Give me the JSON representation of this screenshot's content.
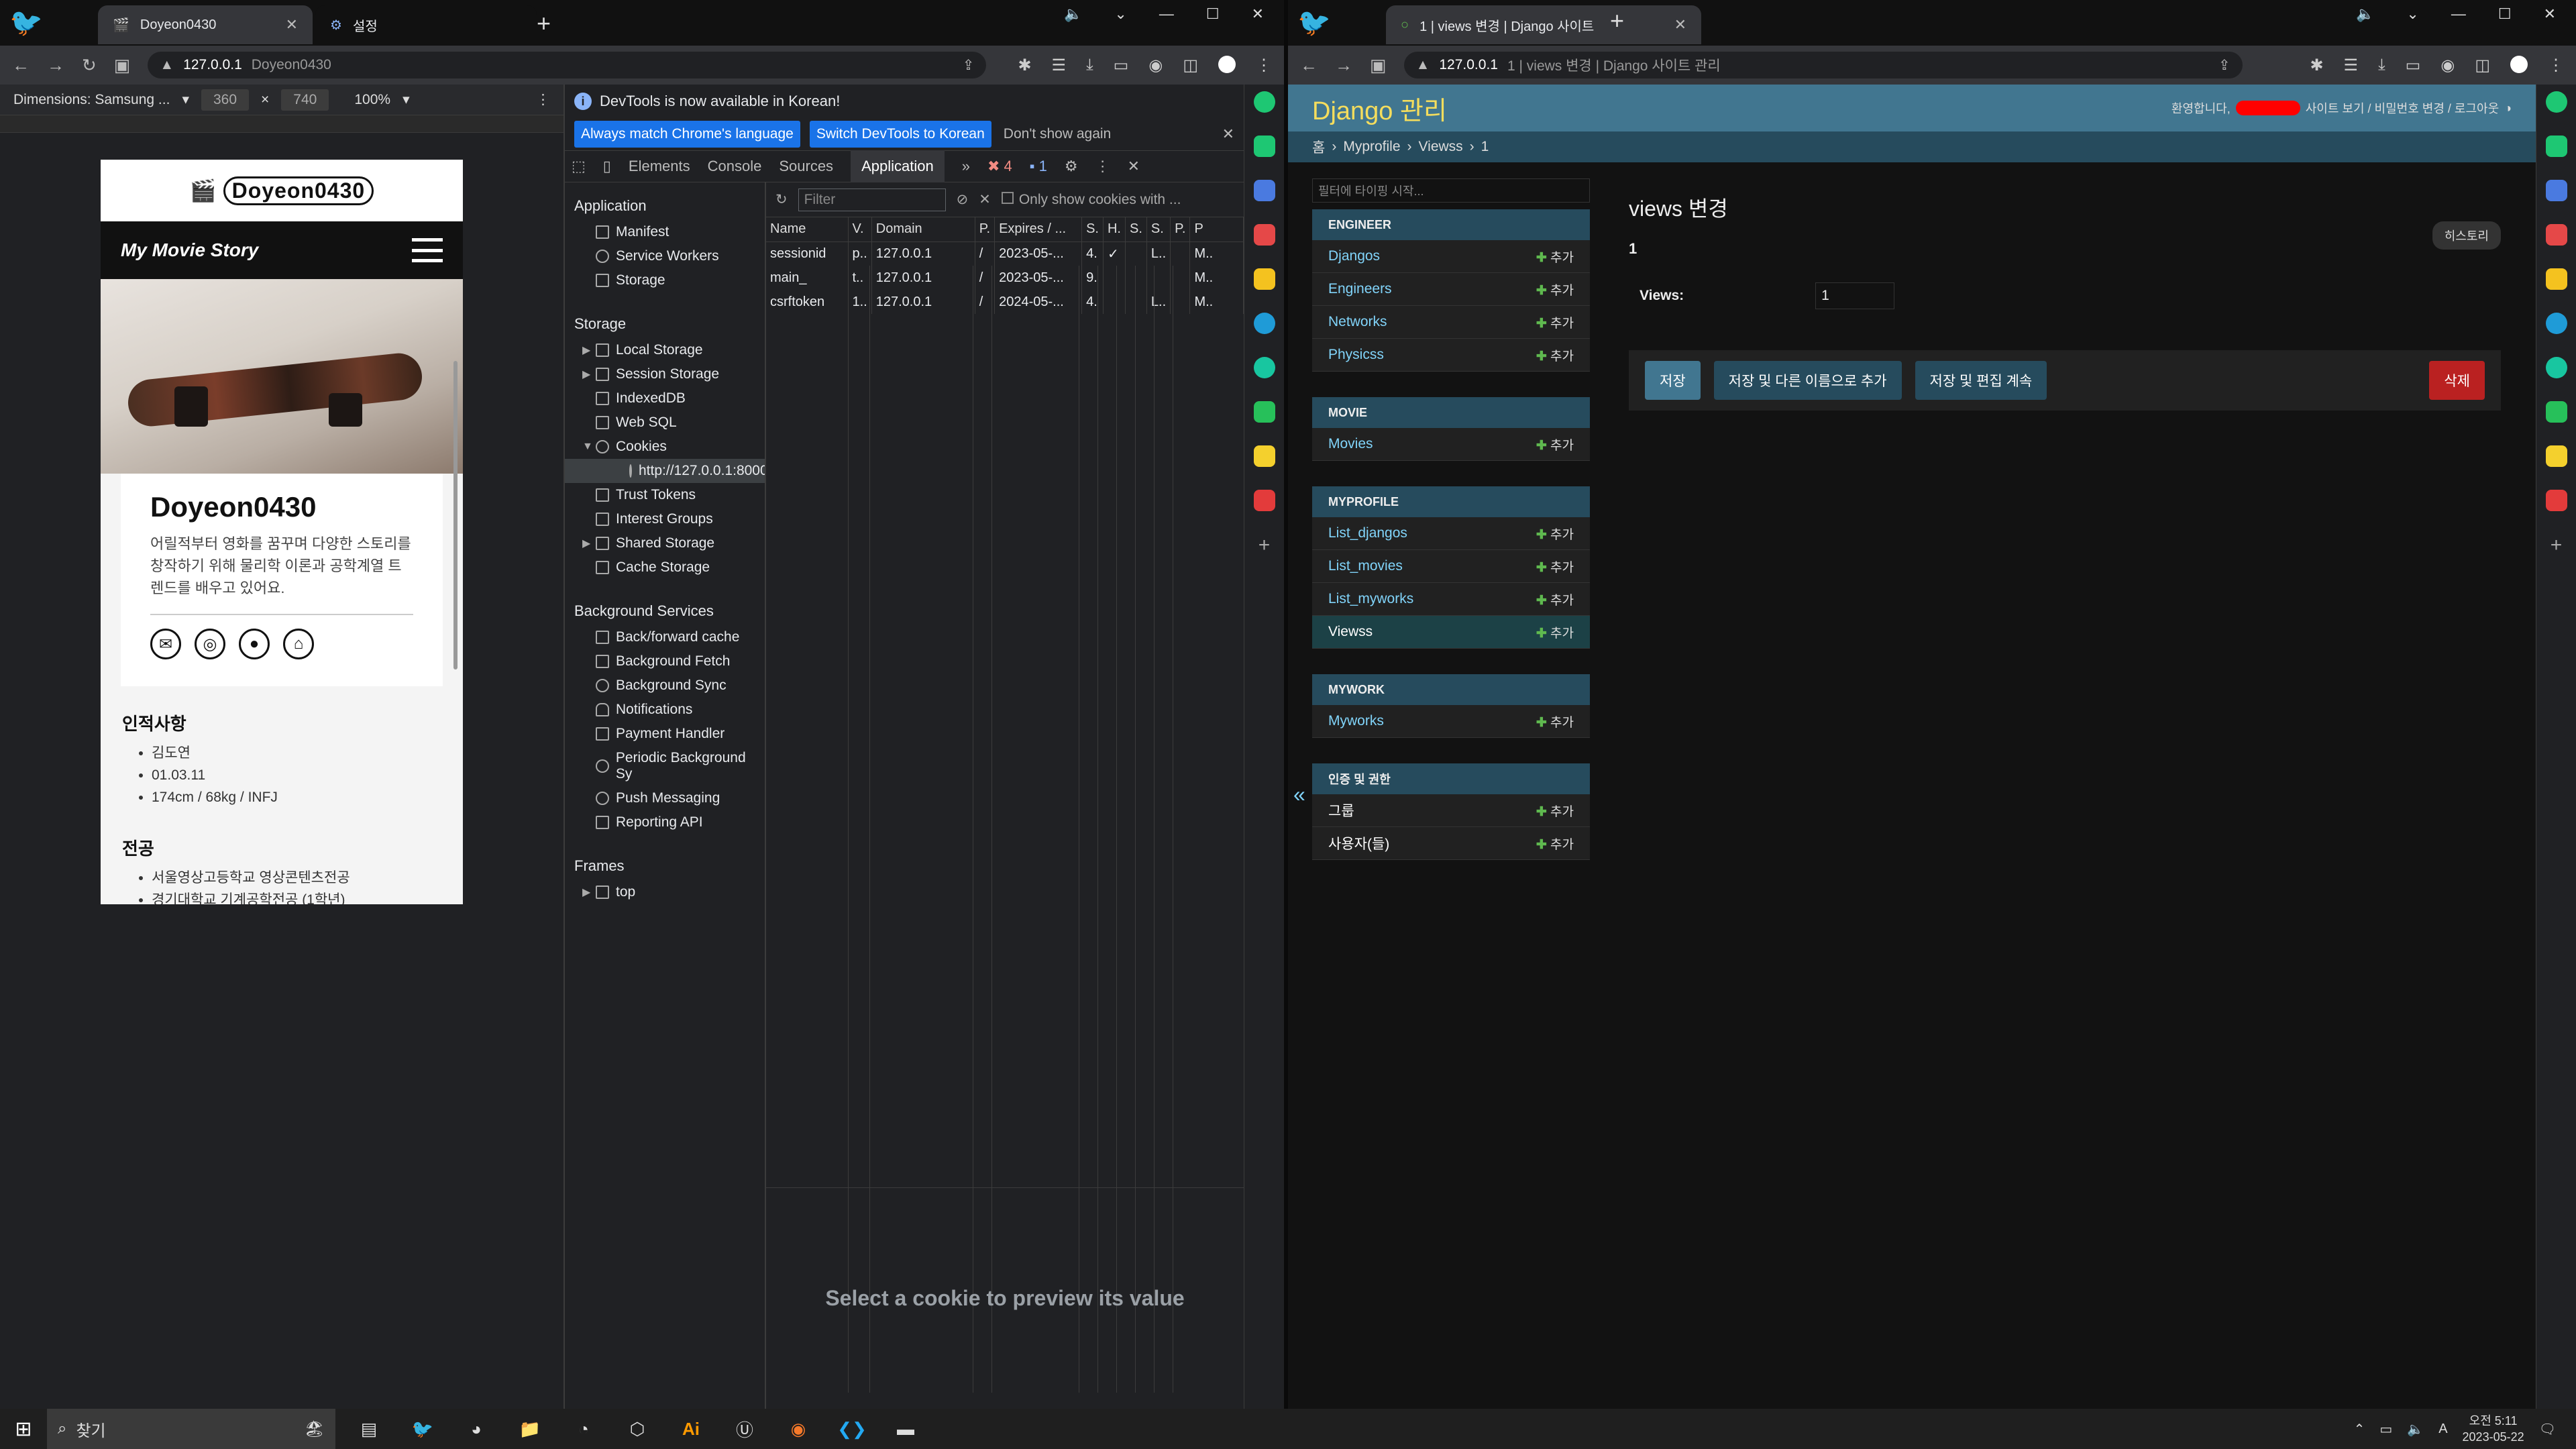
{
  "left": {
    "tab_title": "Doyeon0430",
    "url_host": "127.0.0.1",
    "url_rest": "Doyeon0430",
    "device": {
      "label": "Dimensions: Samsung ...",
      "width": "360",
      "height": "740",
      "zoom": "100%"
    },
    "phone": {
      "logo": "Doyeon0430",
      "nav_title": "My Movie Story",
      "name": "Doyeon0430",
      "bio": "어릴적부터 영화를 꿈꾸며 다양한 스토리를 창작하기 위해 물리학 이론과 공학계열 트렌드를 배우고 있어요.",
      "sections": [
        {
          "title": "인적사항",
          "items": [
            "김도연",
            "01.03.11",
            "174cm / 68kg / INFJ"
          ]
        },
        {
          "title": "전공",
          "items": [
            "서울영상고등학교 영상콘텐츠전공",
            "경기대학교 기계공학전공 (1학년)"
          ]
        }
      ]
    },
    "devtools": {
      "banner": "DevTools is now available in Korean!",
      "btn_match": "Always match Chrome's language",
      "btn_switch": "Switch DevTools to Korean",
      "btn_dismiss": "Don't show again",
      "tabs": [
        "Elements",
        "Console",
        "Sources",
        "Application"
      ],
      "errors": "4",
      "messages": "1",
      "sidebar": {
        "application_title": "Application",
        "application": [
          "Manifest",
          "Service Workers",
          "Storage"
        ],
        "storage_title": "Storage",
        "storage": [
          "Local Storage",
          "Session Storage",
          "IndexedDB",
          "Web SQL",
          "Cookies",
          "http://127.0.0.1:8000",
          "Trust Tokens",
          "Interest Groups",
          "Shared Storage",
          "Cache Storage"
        ],
        "bg_title": "Background Services",
        "bg": [
          "Back/forward cache",
          "Background Fetch",
          "Background Sync",
          "Notifications",
          "Payment Handler",
          "Periodic Background Sy",
          "Push Messaging",
          "Reporting API"
        ],
        "frames_title": "Frames",
        "frames": [
          "top"
        ]
      },
      "filter_placeholder": "Filter",
      "only_show": "Only show cookies with ...",
      "columns": [
        "Name",
        "V.",
        "Domain",
        "P.",
        "Expires / ...",
        "S.",
        "H.",
        "S.",
        "S.",
        "P.",
        "P"
      ],
      "rows": [
        [
          "sessionid",
          "p..",
          "127.0.0.1",
          "/",
          "2023-05-...",
          "4.",
          "✓",
          "",
          "L..",
          "",
          "M.."
        ],
        [
          "main_",
          "t..",
          "127.0.0.1",
          "/",
          "2023-05-...",
          "9.",
          "",
          "",
          "",
          "",
          "M.."
        ],
        [
          "csrftoken",
          "1..",
          "127.0.0.1",
          "/",
          "2024-05-...",
          "4.",
          "",
          "",
          "L..",
          "",
          "M.."
        ]
      ],
      "preview": "Select a cookie to preview its value"
    }
  },
  "right": {
    "tab_title": "1 | views 변경 | Django 사이트",
    "url_host": "127.0.0.1",
    "url_rest": "1 | views 변경 | Django 사이트 관리",
    "django": {
      "brand": "Django 관리",
      "welcome": "환영합니다,",
      "user_links": "사이트 보기 / 비밀번호 변경 / 로그아웃",
      "breadcrumb": [
        "홈",
        "Myprofile",
        "Viewss",
        "1"
      ],
      "filter_placeholder": "필터에 타이핑 시작...",
      "add_label": "추가",
      "modules": [
        {
          "caption": "ENGINEER",
          "rows": [
            "Djangos",
            "Engineers",
            "Networks",
            "Physicss"
          ]
        },
        {
          "caption": "MOVIE",
          "rows": [
            "Movies"
          ]
        },
        {
          "caption": "MYPROFILE",
          "rows": [
            "List_djangos",
            "List_movies",
            "List_myworks",
            "Viewss"
          ]
        },
        {
          "caption": "MYWORK",
          "rows": [
            "Myworks"
          ]
        },
        {
          "caption": "인증 및 권한",
          "rows": [
            "그룹",
            "사용자(들)"
          ]
        }
      ],
      "title": "views 변경",
      "history": "히스토리",
      "object": "1",
      "field_label": "Views:",
      "field_value": "1",
      "btn_save": "저장",
      "btn_save_add": "저장 및 다른 이름으로 추가",
      "btn_save_continue": "저장 및 편집 계속",
      "btn_delete": "삭제"
    }
  },
  "taskbar": {
    "search": "찾기",
    "time": "오전 5:11",
    "date": "2023-05-22",
    "lang": "A"
  }
}
